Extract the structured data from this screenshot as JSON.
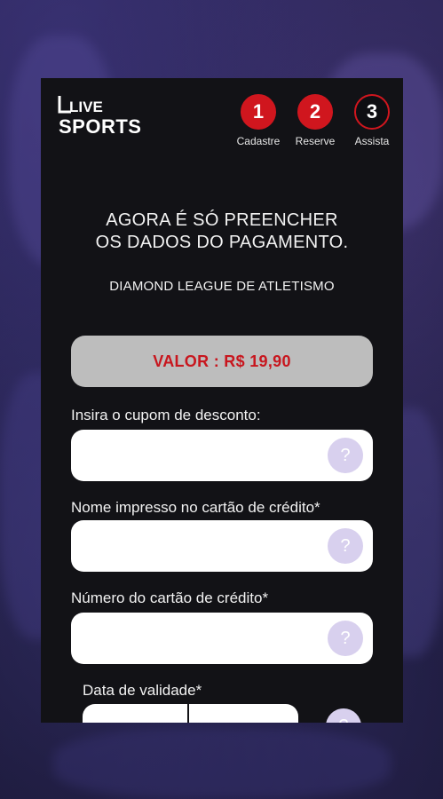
{
  "brand": {
    "logo_text_line1": "LIVE",
    "logo_text_line2": "SPORTS"
  },
  "steps": [
    {
      "number": "1",
      "label": "Cadastre",
      "state": "done"
    },
    {
      "number": "2",
      "label": "Reserve",
      "state": "done"
    },
    {
      "number": "3",
      "label": "Assista",
      "state": "current"
    }
  ],
  "headline": {
    "line1": "AGORA É SÓ PREENCHER",
    "line2": "OS DADOS DO PAGAMENTO."
  },
  "event_name": "DIAMOND LEAGUE DE ATLETISMO",
  "price": {
    "text": "VALOR : R$ 19,90"
  },
  "form": {
    "coupon_label": "Insira o cupom de desconto:",
    "coupon_value": "",
    "card_name_label": "Nome impresso no cartão de crédito*",
    "card_name_value": "",
    "card_number_label": "Número do cartão de crédito*",
    "card_number_value": "",
    "expiry_label": "Data de validade*",
    "help_glyph": "?"
  },
  "colors": {
    "accent_red": "#d0161e",
    "panel_bg": "#121216",
    "price_box_bg": "#bdbdbd",
    "help_bubble": "#d8d0ee"
  },
  "icons": {
    "help": "question-mark-icon"
  }
}
